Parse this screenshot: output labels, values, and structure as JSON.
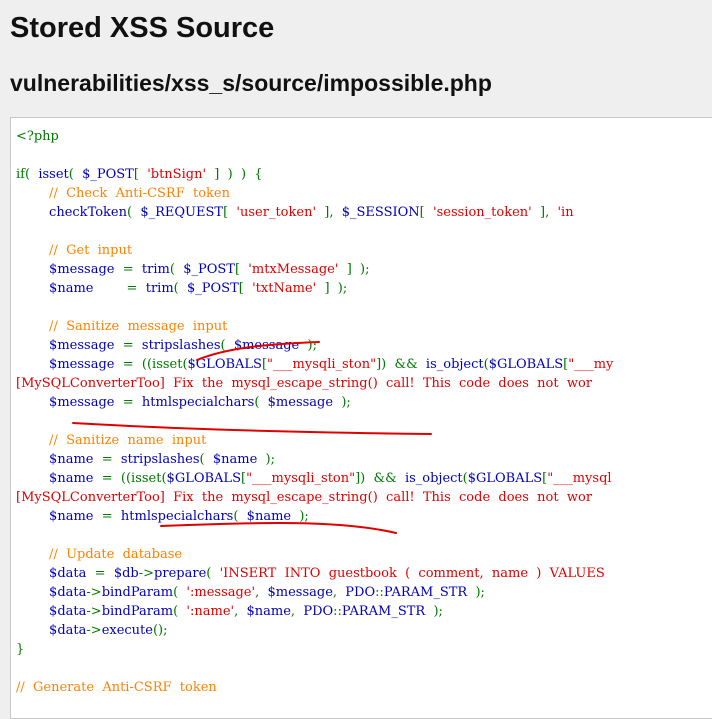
{
  "page": {
    "title": "Stored XSS Source",
    "subtitle": "vulnerabilities/xss_s/source/impossible.php"
  },
  "colors": {
    "php_default": "#0000bb",
    "php_comment": "#ff8000",
    "php_string": "#dd0000",
    "php_keyword": "#007700",
    "annotation_underline": "#e00000"
  },
  "code": {
    "lines": [
      [
        {
          "c": "keyword",
          "t": "<?php"
        }
      ],
      [],
      [
        {
          "c": "keyword",
          "t": "if(  "
        },
        {
          "c": "default",
          "t": "isset"
        },
        {
          "c": "keyword",
          "t": "(  "
        },
        {
          "c": "default",
          "t": "$_POST"
        },
        {
          "c": "keyword",
          "t": "[  "
        },
        {
          "c": "string",
          "t": "'btnSign'"
        },
        {
          "c": "keyword",
          "t": "  ]  )  )  {"
        }
      ],
      [
        {
          "c": "comment",
          "t": "        //  Check  Anti-CSRF  token"
        }
      ],
      [
        {
          "c": "default",
          "t": "        checkToken"
        },
        {
          "c": "keyword",
          "t": "(  "
        },
        {
          "c": "default",
          "t": "$_REQUEST"
        },
        {
          "c": "keyword",
          "t": "[  "
        },
        {
          "c": "string",
          "t": "'user_token'"
        },
        {
          "c": "keyword",
          "t": "  ],  "
        },
        {
          "c": "default",
          "t": "$_SESSION"
        },
        {
          "c": "keyword",
          "t": "[  "
        },
        {
          "c": "string",
          "t": "'session_token'"
        },
        {
          "c": "keyword",
          "t": "  ],  "
        },
        {
          "c": "string",
          "t": "'in"
        }
      ],
      [],
      [
        {
          "c": "comment",
          "t": "        //  Get  input"
        }
      ],
      [
        {
          "c": "default",
          "t": "        $message  "
        },
        {
          "c": "keyword",
          "t": "=  "
        },
        {
          "c": "default",
          "t": "trim"
        },
        {
          "c": "keyword",
          "t": "(  "
        },
        {
          "c": "default",
          "t": "$_POST"
        },
        {
          "c": "keyword",
          "t": "[  "
        },
        {
          "c": "string",
          "t": "'mtxMessage'"
        },
        {
          "c": "keyword",
          "t": "  ]  );"
        }
      ],
      [
        {
          "c": "default",
          "t": "        $name        "
        },
        {
          "c": "keyword",
          "t": "=  "
        },
        {
          "c": "default",
          "t": "trim"
        },
        {
          "c": "keyword",
          "t": "(  "
        },
        {
          "c": "default",
          "t": "$_POST"
        },
        {
          "c": "keyword",
          "t": "[  "
        },
        {
          "c": "string",
          "t": "'txtName'"
        },
        {
          "c": "keyword",
          "t": "  ]  );"
        }
      ],
      [],
      [
        {
          "c": "comment",
          "t": "        //  Sanitize  message  input"
        }
      ],
      [
        {
          "c": "default",
          "t": "        $message  "
        },
        {
          "c": "keyword",
          "t": "=  "
        },
        {
          "c": "default",
          "t": "stripslashes"
        },
        {
          "c": "keyword",
          "t": "(  "
        },
        {
          "c": "default",
          "t": "$message"
        },
        {
          "c": "keyword",
          "t": "  );"
        }
      ],
      [
        {
          "c": "default",
          "t": "        $message  "
        },
        {
          "c": "keyword",
          "t": "=  ((isset("
        },
        {
          "c": "default",
          "t": "$GLOBALS"
        },
        {
          "c": "keyword",
          "t": "["
        },
        {
          "c": "string",
          "t": "\"___mysqli_ston\""
        },
        {
          "c": "keyword",
          "t": "])  &&  "
        },
        {
          "c": "default",
          "t": "is_object"
        },
        {
          "c": "keyword",
          "t": "("
        },
        {
          "c": "default",
          "t": "$GLOBALS"
        },
        {
          "c": "keyword",
          "t": "["
        },
        {
          "c": "string",
          "t": "\"___my"
        }
      ],
      [
        {
          "c": "string",
          "t": "[MySQLConverterToo]  Fix  the  mysql_escape_string()  call!  This  code  does  not  wor"
        }
      ],
      [
        {
          "c": "default",
          "t": "        $message  "
        },
        {
          "c": "keyword",
          "t": "=  "
        },
        {
          "c": "default",
          "t": "htmlspecialchars"
        },
        {
          "c": "keyword",
          "t": "(  "
        },
        {
          "c": "default",
          "t": "$message"
        },
        {
          "c": "keyword",
          "t": "  );"
        }
      ],
      [],
      [
        {
          "c": "comment",
          "t": "        //  Sanitize  name  input"
        }
      ],
      [
        {
          "c": "default",
          "t": "        $name  "
        },
        {
          "c": "keyword",
          "t": "=  "
        },
        {
          "c": "default",
          "t": "stripslashes"
        },
        {
          "c": "keyword",
          "t": "(  "
        },
        {
          "c": "default",
          "t": "$name"
        },
        {
          "c": "keyword",
          "t": "  );"
        }
      ],
      [
        {
          "c": "default",
          "t": "        $name  "
        },
        {
          "c": "keyword",
          "t": "=  ((isset("
        },
        {
          "c": "default",
          "t": "$GLOBALS"
        },
        {
          "c": "keyword",
          "t": "["
        },
        {
          "c": "string",
          "t": "\"___mysqli_ston\""
        },
        {
          "c": "keyword",
          "t": "])  &&  "
        },
        {
          "c": "default",
          "t": "is_object"
        },
        {
          "c": "keyword",
          "t": "("
        },
        {
          "c": "default",
          "t": "$GLOBALS"
        },
        {
          "c": "keyword",
          "t": "["
        },
        {
          "c": "string",
          "t": "\"___mysql"
        }
      ],
      [
        {
          "c": "string",
          "t": "[MySQLConverterToo]  Fix  the  mysql_escape_string()  call!  This  code  does  not  wor"
        }
      ],
      [
        {
          "c": "default",
          "t": "        $name  "
        },
        {
          "c": "keyword",
          "t": "=  "
        },
        {
          "c": "default",
          "t": "htmlspecialchars"
        },
        {
          "c": "keyword",
          "t": "(  "
        },
        {
          "c": "default",
          "t": "$name"
        },
        {
          "c": "keyword",
          "t": "  );"
        }
      ],
      [],
      [
        {
          "c": "comment",
          "t": "        //  Update  database"
        }
      ],
      [
        {
          "c": "default",
          "t": "        $data  "
        },
        {
          "c": "keyword",
          "t": "=  "
        },
        {
          "c": "default",
          "t": "$db"
        },
        {
          "c": "keyword",
          "t": "->"
        },
        {
          "c": "default",
          "t": "prepare"
        },
        {
          "c": "keyword",
          "t": "(  "
        },
        {
          "c": "string",
          "t": "'INSERT  INTO  guestbook  (  comment,  name  )  VALUES"
        }
      ],
      [
        {
          "c": "default",
          "t": "        $data"
        },
        {
          "c": "keyword",
          "t": "->"
        },
        {
          "c": "default",
          "t": "bindParam"
        },
        {
          "c": "keyword",
          "t": "(  "
        },
        {
          "c": "string",
          "t": "':message'"
        },
        {
          "c": "keyword",
          "t": ",  "
        },
        {
          "c": "default",
          "t": "$message"
        },
        {
          "c": "keyword",
          "t": ",  "
        },
        {
          "c": "default",
          "t": "PDO"
        },
        {
          "c": "keyword",
          "t": "::"
        },
        {
          "c": "default",
          "t": "PARAM_STR"
        },
        {
          "c": "keyword",
          "t": "  );"
        }
      ],
      [
        {
          "c": "default",
          "t": "        $data"
        },
        {
          "c": "keyword",
          "t": "->"
        },
        {
          "c": "default",
          "t": "bindParam"
        },
        {
          "c": "keyword",
          "t": "(  "
        },
        {
          "c": "string",
          "t": "':name'"
        },
        {
          "c": "keyword",
          "t": ",  "
        },
        {
          "c": "default",
          "t": "$name"
        },
        {
          "c": "keyword",
          "t": ",  "
        },
        {
          "c": "default",
          "t": "PDO"
        },
        {
          "c": "keyword",
          "t": "::"
        },
        {
          "c": "default",
          "t": "PARAM_STR"
        },
        {
          "c": "keyword",
          "t": "  );"
        }
      ],
      [
        {
          "c": "default",
          "t": "        $data"
        },
        {
          "c": "keyword",
          "t": "->"
        },
        {
          "c": "default",
          "t": "execute"
        },
        {
          "c": "keyword",
          "t": "();"
        }
      ],
      [
        {
          "c": "keyword",
          "t": "}"
        }
      ],
      [],
      [
        {
          "c": "comment",
          "t": "//  Generate  Anti-CSRF  token"
        }
      ]
    ]
  }
}
